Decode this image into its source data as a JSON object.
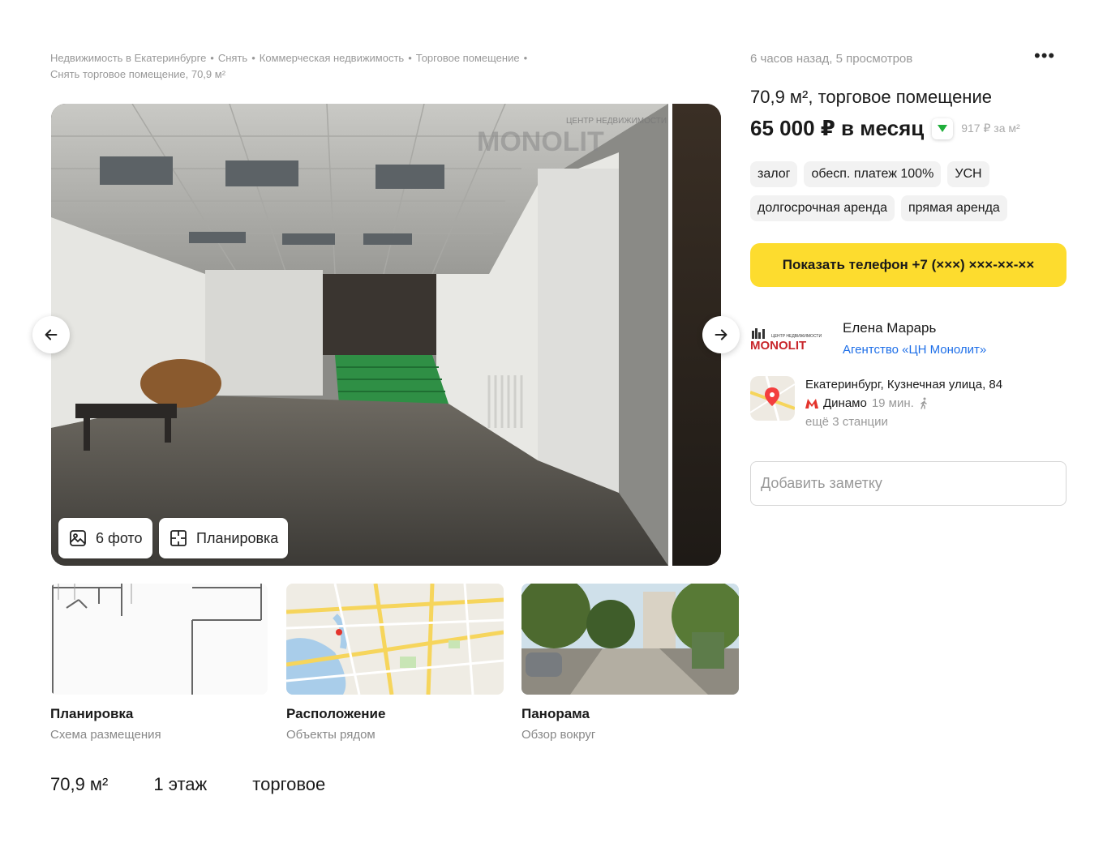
{
  "breadcrumb": {
    "items": [
      "Недвижимость в Екатеринбурге",
      "Снять",
      "Коммерческая недвижимость",
      "Торговое помещение",
      "Снять торговое помещение, 70,9 м²"
    ],
    "separator": "•"
  },
  "gallery": {
    "photos_label": "6 фото",
    "plan_label": "Планировка",
    "watermark_small": "ЦЕНТР НЕДВИЖИМОСТИ",
    "watermark_big": "MONOLIT"
  },
  "thumbs": [
    {
      "title": "Планировка",
      "subtitle": "Схема размещения"
    },
    {
      "title": "Расположение",
      "subtitle": "Объекты рядом"
    },
    {
      "title": "Панорама",
      "subtitle": "Обзор вокруг"
    }
  ],
  "facts": [
    "70,9 м²",
    "1 этаж",
    "торговое"
  ],
  "listing": {
    "meta": "6 часов назад, 5 просмотров",
    "more": "•••",
    "title": "70,9 м², торговое помещение",
    "price": "65 000 ₽ в месяц",
    "price_per": "917 ₽ за м²",
    "price_trend_color": "#1fae3a",
    "tags": [
      "залог",
      "обесп. платеж 100%",
      "УСН",
      "долгосрочная аренда",
      "прямая аренда"
    ],
    "phone_button": "Показать телефон +7 (×××) ×××-××-××",
    "accent_color": "#fddc2e"
  },
  "agent": {
    "logo_small": "ЦЕНТР НЕДВИЖИМОСТИ",
    "logo_big": "MONOLIT",
    "name": "Елена Марарь",
    "agency": "Агентство «ЦН Монолит»"
  },
  "location": {
    "address": "Екатеринбург, Кузнечная улица, 84",
    "metro_name": "Динамо",
    "metro_time": "19 мин.",
    "more_stations": "ещё 3 станции",
    "metro_color": "#e4342c"
  },
  "note": {
    "placeholder": "Добавить заметку"
  }
}
